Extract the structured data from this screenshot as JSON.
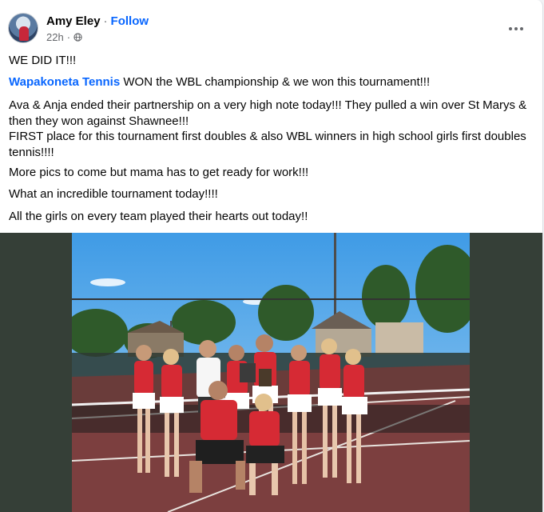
{
  "post": {
    "author": "Amy Eley",
    "separator": "·",
    "follow_label": "Follow",
    "time": "22h",
    "audience_icon": "globe-icon",
    "more_icon": "more-options-icon"
  },
  "content": {
    "line1": "WE DID IT!!!",
    "tag": "Wapakoneta Tennis",
    "line2_rest": " WON the WBL championship & we won this tournament!!!",
    "paragraph3a": " Ava & Anja ended their partnership on a very high note today!!! They pulled a win over St Marys & then they won against Shawnee!!!",
    "paragraph3b": "FIRST place for this tournament first doubles & also WBL winners in high school girls first doubles tennis!!!!",
    "line4": "More pics to come but mama has to get ready for work!!!",
    "line5": "What an incredible tournament today!!!!",
    "line6": "All the girls on every team played their hearts out today!!"
  },
  "colors": {
    "link": "#0866ff",
    "photo_backdrop": "#353f37",
    "jersey_red": "#d62a34"
  }
}
